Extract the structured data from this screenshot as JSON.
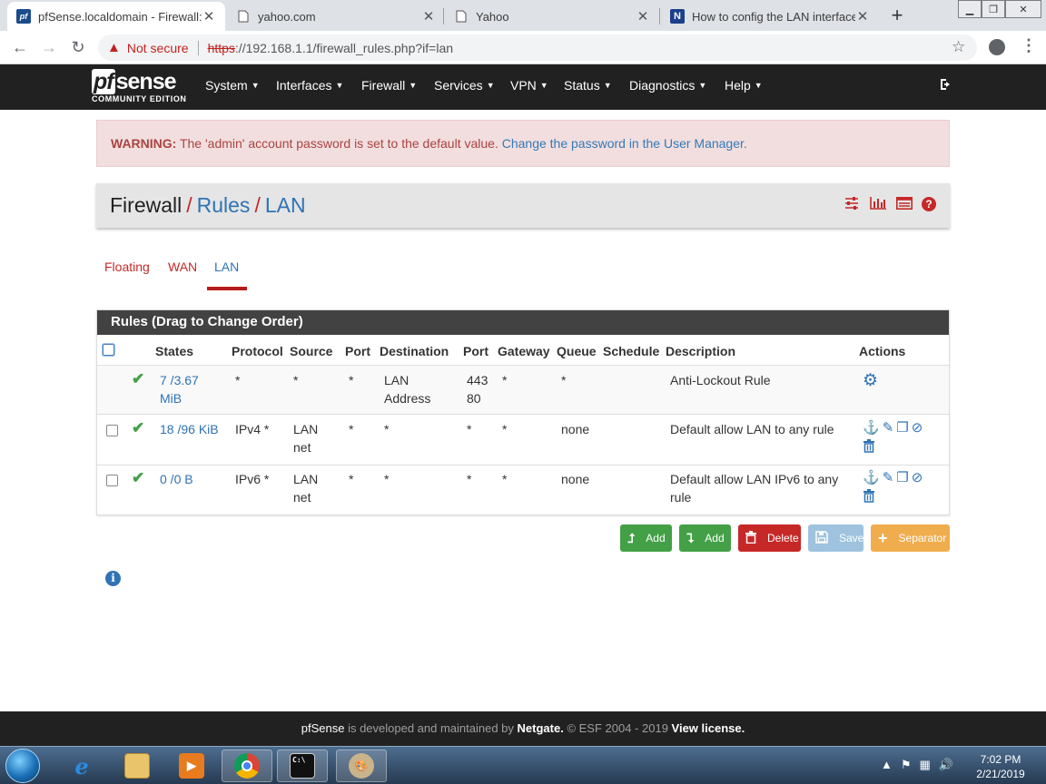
{
  "browser": {
    "tabs": [
      {
        "title": "pfSense.localdomain - Firewall: R",
        "favicon": "pfsense-favicon",
        "active": true
      },
      {
        "title": "yahoo.com",
        "favicon": "page-icon",
        "active": false
      },
      {
        "title": "Yahoo",
        "favicon": "page-icon",
        "active": false
      },
      {
        "title": "How to config the LAN interface",
        "favicon": "netgate-favicon",
        "active": false
      }
    ],
    "new_tab": "+",
    "security_label": "Not secure",
    "url_scheme": "https",
    "url_rest": "://192.168.1.1/firewall_rules.php?if=lan"
  },
  "nav": {
    "brand": "sense",
    "brand_prefix": "pf",
    "edition": "COMMUNITY EDITION",
    "menus": [
      "System",
      "Interfaces",
      "Firewall",
      "Services",
      "VPN",
      "Status",
      "Diagnostics",
      "Help"
    ]
  },
  "alert": {
    "label": "WARNING:",
    "text": " The 'admin' account password is set to the default value. ",
    "link": "Change the password in the User Manager."
  },
  "breadcrumb": {
    "root": "Firewall",
    "sep": "/",
    "level2": "Rules",
    "level3": "LAN"
  },
  "iface_tabs": [
    "Floating",
    "WAN",
    "LAN"
  ],
  "rules": {
    "title": "Rules (Drag to Change Order)",
    "headers": [
      "States",
      "Protocol",
      "Source",
      "Port",
      "Destination",
      "Port",
      "Gateway",
      "Queue",
      "Schedule",
      "Description",
      "Actions"
    ],
    "rows": [
      {
        "states": [
          "7 /3.67",
          "MiB"
        ],
        "protocol": "*",
        "source": [
          "*"
        ],
        "sport": "*",
        "dest": [
          "LAN",
          "Address"
        ],
        "dport": [
          "443",
          "80"
        ],
        "gateway": "*",
        "queue": "*",
        "schedule": "",
        "description": [
          "Anti-Lockout Rule"
        ]
      },
      {
        "states": [
          "18 /96 KiB"
        ],
        "protocol": "IPv4 *",
        "source": [
          "LAN",
          "net"
        ],
        "sport": "*",
        "dest": [
          "*"
        ],
        "dport": [
          "*"
        ],
        "gateway": "*",
        "queue": "none",
        "schedule": "",
        "description": [
          "Default allow LAN to any rule"
        ]
      },
      {
        "states": [
          "0 /0 B"
        ],
        "protocol": "IPv6 *",
        "source": [
          "LAN",
          "net"
        ],
        "sport": "*",
        "dest": [
          "*"
        ],
        "dport": [
          "*"
        ],
        "gateway": "*",
        "queue": "none",
        "schedule": "",
        "description": [
          "Default allow LAN IPv6 to any",
          "rule"
        ]
      }
    ]
  },
  "buttons": {
    "add_top": "Add",
    "add_bottom": "Add",
    "delete": "Delete",
    "save": "Save",
    "separator": "Separator"
  },
  "footer": {
    "product": "pfSense",
    "text1": " is developed and maintained by ",
    "company": "Netgate.",
    "text2": " © ESF 2004 - 2019 ",
    "license": "View license."
  },
  "taskbar": {
    "time": "7:02 PM",
    "date": "2/21/2019"
  },
  "colors": {
    "navbar": "#212121",
    "accent_red": "#c62828",
    "link_blue": "#2f73b5",
    "success_green": "#43a047",
    "warning_orange": "#f0ad4e"
  }
}
